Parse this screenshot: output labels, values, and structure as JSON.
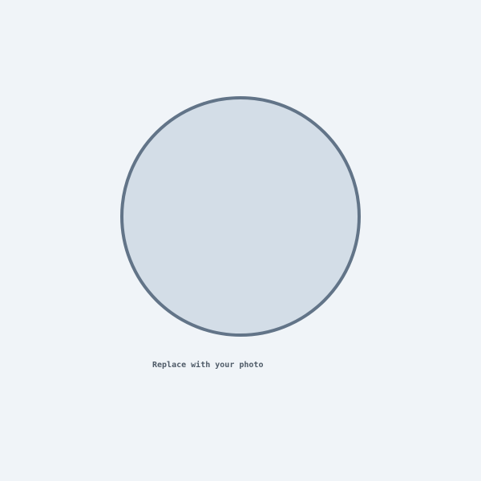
{
  "placeholder": {
    "caption": "Replace with your photo"
  },
  "colors": {
    "background": "#f0f4f8",
    "circle_fill": "#d3dde7",
    "circle_border": "#627488",
    "caption_text": "#4f5b68"
  }
}
